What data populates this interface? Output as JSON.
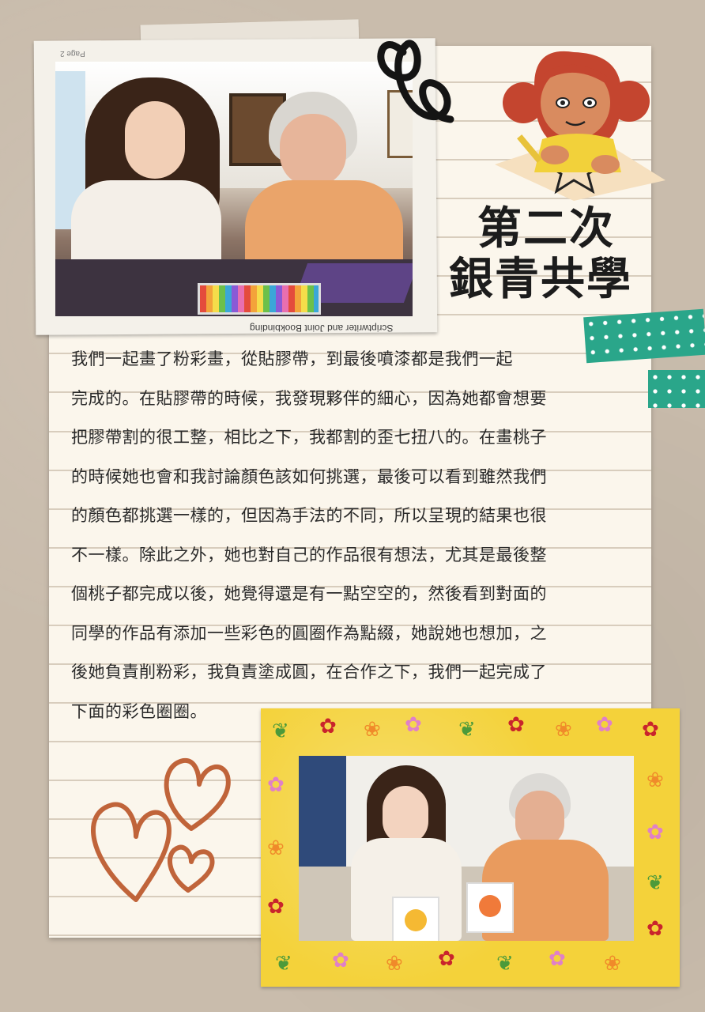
{
  "title": {
    "line1": "第二次",
    "line2": "銀青共學"
  },
  "photo1": {
    "caption_flipped": "Scriptwriter and Joint Bookbinding",
    "page_flipped": "Page 2"
  },
  "body": {
    "lines": [
      "我們一起畫了粉彩畫，從貼膠帶，到最後噴漆都是我們一起",
      "完成的。在貼膠帶的時候，我發現夥伴的細心，因為她都會想要",
      "把膠帶割的很工整，相比之下，我都割的歪七扭八的。在畫桃子",
      "的時候她也會和我討論顏色該如何挑選，最後可以看到雖然我們",
      "的顏色都挑選一樣的，但因為手法的不同，所以呈現的結果也很",
      "不一樣。除此之外，她也對自己的作品很有想法，尤其是最後整",
      "個桃子都完成以後，她覺得還是有一點空空的，然後看到對面的",
      "同學的作品有添加一些彩色的圓圈作為點綴，她說她也想加，之",
      "後她負責削粉彩，我負責塗成圓，在合作之下，我們一起完成了",
      "下面的彩色圈圈。"
    ]
  },
  "colors": {
    "background": "#c9bcac",
    "paper": "#fbf6ec",
    "washi_teal": "#2aa68a",
    "frame_yellow": "#f4d23a",
    "heart_brown": "#c0643a"
  }
}
